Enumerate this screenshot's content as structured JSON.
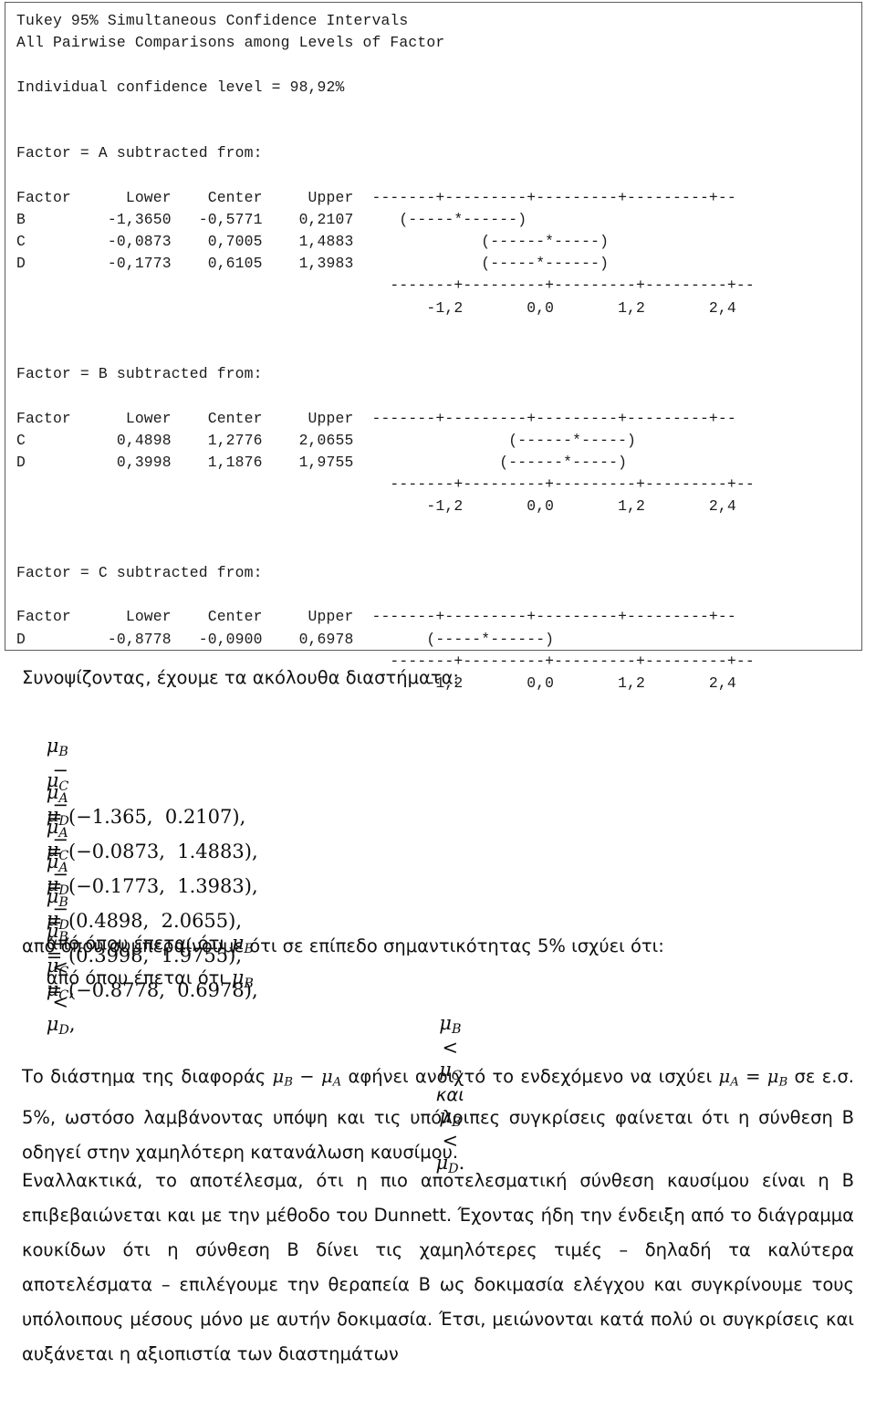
{
  "minitab": {
    "title_line_1": "Tukey 95% Simultaneous Confidence Intervals",
    "title_line_2": "All Pairwise Comparisons among Levels of Factor",
    "confidence_line": "Individual confidence level = 98,92%",
    "sections": [
      {
        "heading": "Factor = A subtracted from:",
        "columns": [
          "Factor",
          "Lower",
          "Center",
          "Upper"
        ],
        "rows": [
          {
            "factor": "B",
            "lower": "-1,3650",
            "center": "-0,5771",
            "upper": "0,2107"
          },
          {
            "factor": "C",
            "lower": "-0,0873",
            "center": "0,7005",
            "upper": "1,4883"
          },
          {
            "factor": "D",
            "lower": "-0,1773",
            "center": "0,6105",
            "upper": "1,3983"
          }
        ],
        "axis_rule": "-------+---------+---------+---------+--",
        "interval_art": [
          "   (-----*------)",
          "            (------*-----)",
          "            (-----*------)"
        ],
        "tick_labels": [
          "-1,2",
          "0,0",
          "1,2",
          "2,4"
        ],
        "tick_label_line": "    -1,2       0,0       1,2       2,4"
      },
      {
        "heading": "Factor = B subtracted from:",
        "columns": [
          "Factor",
          "Lower",
          "Center",
          "Upper"
        ],
        "rows": [
          {
            "factor": "C",
            "lower": "0,4898",
            "center": "1,2776",
            "upper": "2,0655"
          },
          {
            "factor": "D",
            "lower": "0,3998",
            "center": "1,1876",
            "upper": "1,9755"
          }
        ],
        "axis_rule": "-------+---------+---------+---------+--",
        "interval_art": [
          "                (------*-----)",
          "               (------*-----)"
        ],
        "tick_labels": [
          "-1,2",
          "0,0",
          "1,2",
          "2,4"
        ],
        "tick_label_line": "    -1,2       0,0       1,2       2,4"
      },
      {
        "heading": "Factor = C subtracted from:",
        "columns": [
          "Factor",
          "Lower",
          "Center",
          "Upper"
        ],
        "rows": [
          {
            "factor": "D",
            "lower": "-0,8778",
            "center": "-0,0900",
            "upper": "0,6978"
          }
        ],
        "axis_rule": "-------+---------+---------+---------+--",
        "interval_art": [
          "      (-----*------)"
        ],
        "tick_labels": [
          "-1,2",
          "0,0",
          "1,2",
          "2,4"
        ],
        "tick_label_line": "    -1,2       0,0       1,2       2,4"
      }
    ],
    "full_text": "Tukey 95% Simultaneous Confidence Intervals\nAll Pairwise Comparisons among Levels of Factor\n\nIndividual confidence level = 98,92%\n\n\nFactor = A subtracted from:\n\nFactor      Lower    Center     Upper  -------+---------+---------+---------+--\nB         -1,3650   -0,5771    0,2107     (-----*------)\nC         -0,0873    0,7005    1,4883              (------*-----)\nD         -0,1773    0,6105    1,3983              (-----*------)\n                                         -------+---------+---------+---------+--\n                                             -1,2       0,0       1,2       2,4\n\n\nFactor = B subtracted from:\n\nFactor      Lower    Center     Upper  -------+---------+---------+---------+--\nC          0,4898    1,2776    2,0655                 (------*-----)\nD          0,3998    1,1876    1,9755                (------*-----)\n                                         -------+---------+---------+---------+--\n                                             -1,2       0,0       1,2       2,4\n\n\nFactor = C subtracted from:\n\nFactor      Lower    Center     Upper  -------+---------+---------+---------+--\nD         -0,8778   -0,0900    0,6978        (-----*------)\n                                         -------+---------+---------+---------+--\n                                             -1,2       0,0       1,2       2,4"
  },
  "prose": {
    "intro": "Συνοψίζοντας, έχουμε τα ακόλουθα διαστήματα:",
    "equations": [
      {
        "lhs_a": "B",
        "lhs_b": "A",
        "interval": "= (−1.365,  0.2107),",
        "note": ""
      },
      {
        "lhs_a": "C",
        "lhs_b": "A",
        "interval": "= (−0.0873,  1.4883),",
        "note": ""
      },
      {
        "lhs_a": "D",
        "lhs_b": "A",
        "interval": "= (−0.1773,  1.3983),",
        "note": ""
      },
      {
        "lhs_a": "C",
        "lhs_b": "B",
        "interval": "= (0.4898,  2.0655),",
        "note": "από όπου έπεται ότι",
        "note_a": "B",
        "note_b": "C",
        "note_tail": ","
      },
      {
        "lhs_a": "D",
        "lhs_b": "B",
        "interval": "= (0.3998,  1.9755),",
        "note": "από όπου έπεται ότι",
        "note_a": "B",
        "note_b": "D",
        "note_tail": ","
      },
      {
        "lhs_a": "D",
        "lhs_b": "C",
        "interval": "= (−0.8778,  0.6978),",
        "note": ""
      }
    ],
    "conclusion_lead": "από όπου συμπεραίνουμε ότι σε επίπεδο σημαντικότητας 5% ισχύει ότι:",
    "centered_result": {
      "a": "B",
      "b": "C",
      "conj": "και",
      "c": "B",
      "d": "D",
      "tail": "."
    },
    "paragraph_1_part_1": "Το διάστημα της διαφοράς ",
    "paragraph_1_part_2": " αφήνει ανοιχτό το ενδεχόμενο να ισχύει ",
    "paragraph_1_part_3": " σε ε.σ. 5%, ωστόσο λαμβάνοντας υπόψη και τις υπόλοιπες συγκρίσεις φαίνεται ότι η σύνθεση Β οδηγεί στην χαμηλότερη κατανάλωση καυσίμου.",
    "paragraph_2": "Εναλλακτικά, το αποτέλεσμα, ότι η πιο αποτελεσματική σύνθεση καυσίμου είναι η B επιβεβαιώνεται και με την μέθοδο του Dunnett. Έχοντας ήδη την ένδειξη από το διάγραμμα κουκίδων ότι η σύνθεση B δίνει τις χαμηλότερες τιμές – δηλαδή τα καλύτερα αποτελέσματα – επιλέγουμε την θεραπεία B ως δοκιμασία ελέγχου και συγκρίνουμε τους υπόλοιπους μέσους μόνο με αυτήν δοκιμασία. Έτσι, μειώνονται κατά πολύ οι συγκρίσεις και αυξάνεται η αξιοπιστία των διαστημάτων"
  },
  "colors": {
    "box_border": "#5d5d5d",
    "text": "#111111",
    "mono_text": "#1b1b1b",
    "background": "#ffffff"
  }
}
